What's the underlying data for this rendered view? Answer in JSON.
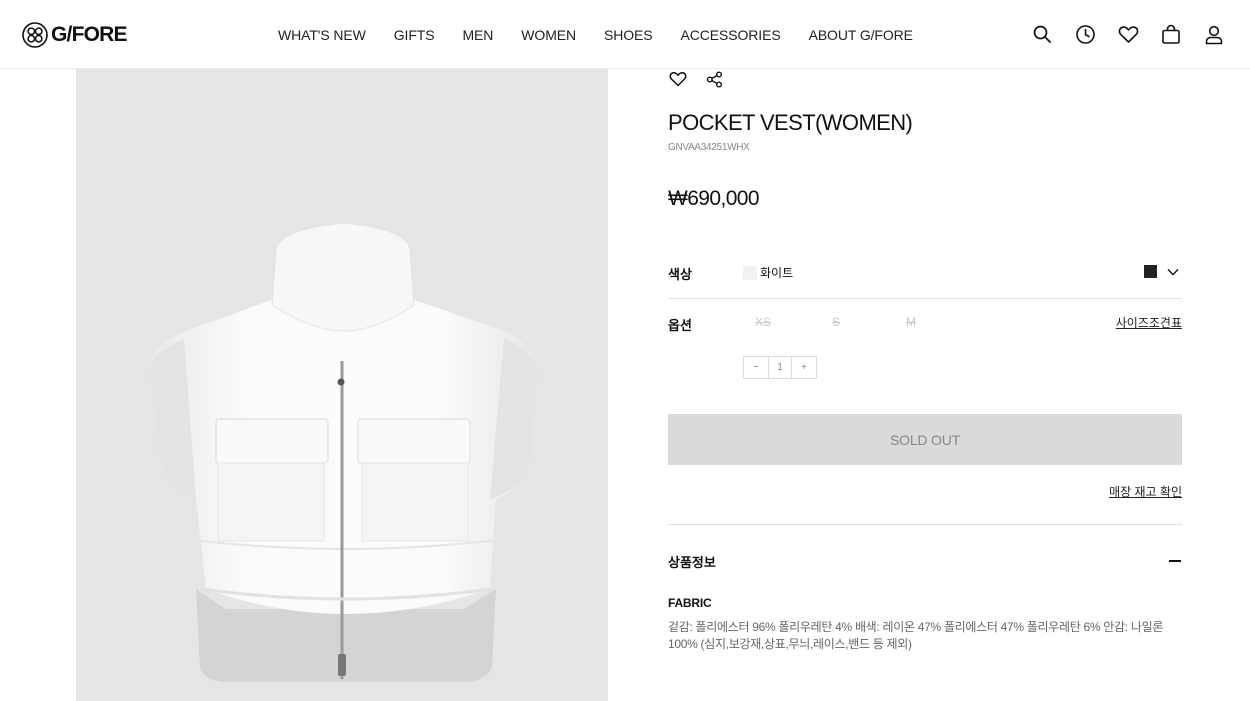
{
  "header": {
    "logo_text": "G/FORE",
    "nav": [
      "WHAT'S NEW",
      "GIFTS",
      "MEN",
      "WOMEN",
      "SHOES",
      "ACCESSORIES",
      "ABOUT G/FORE"
    ],
    "icons": [
      "search-icon",
      "clock-icon",
      "heart-icon",
      "bag-icon",
      "user-icon"
    ]
  },
  "product": {
    "title": "POCKET VEST(WOMEN)",
    "code": "GNVAA34251WHX",
    "price": "₩690,000",
    "color_label": "색상",
    "color_value": "화이트",
    "option_label": "옵션",
    "sizes": [
      "XS",
      "S",
      "M"
    ],
    "size_chart": "사이즈조견표",
    "quantity": "1",
    "qty_minus": "−",
    "qty_plus": "+",
    "sold_out": "SOLD OUT",
    "store_stock": "매장 재고 확인",
    "info_title": "상품정보",
    "fabric_title": "FABRIC",
    "fabric_text": "겉감: 폴리에스터 96% 폴리우레탄 4% 배색: 레이온 47% 폴리에스터 47% 폴리우레탄 6% 안감: 나일론 100% (심지,보강재,상표,무늬,레이스,밴드 등 제외)"
  },
  "colors": {
    "swatch_white": "#f2f2f2",
    "swatch_black": "#222222",
    "soldout_bg": "#dadada",
    "photo_bg": "#e4e5e7"
  }
}
